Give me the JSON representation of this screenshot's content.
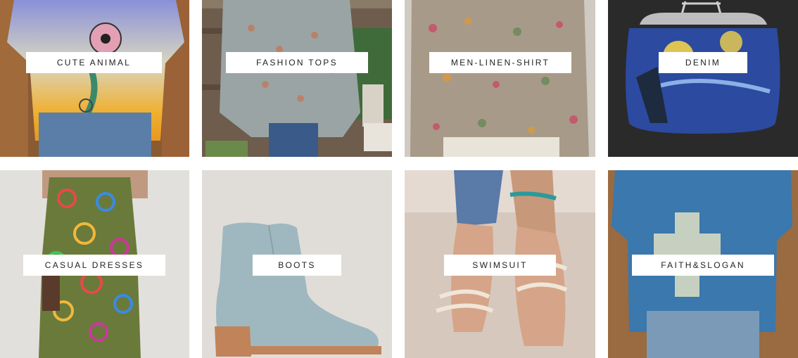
{
  "categories": [
    {
      "label": "CUTE ANIMAL",
      "icon": "cute-animal-tee-photo"
    },
    {
      "label": "FASHION TOPS",
      "icon": "paisley-blouse-photo"
    },
    {
      "label": "MEN-LINEN-SHIRT",
      "icon": "floral-linen-shirt-photo"
    },
    {
      "label": "DENIM",
      "icon": "starry-night-coin-purse-photo"
    },
    {
      "label": "CASUAL DRESSES",
      "icon": "circle-print-dress-photo"
    },
    {
      "label": "BOOTS",
      "icon": "suede-ankle-boot-photo"
    },
    {
      "label": "SWIMSUIT",
      "icon": "strappy-sandals-photo"
    },
    {
      "label": "FAITH&SLOGAN",
      "icon": "jesus-slogan-tee-photo"
    }
  ]
}
